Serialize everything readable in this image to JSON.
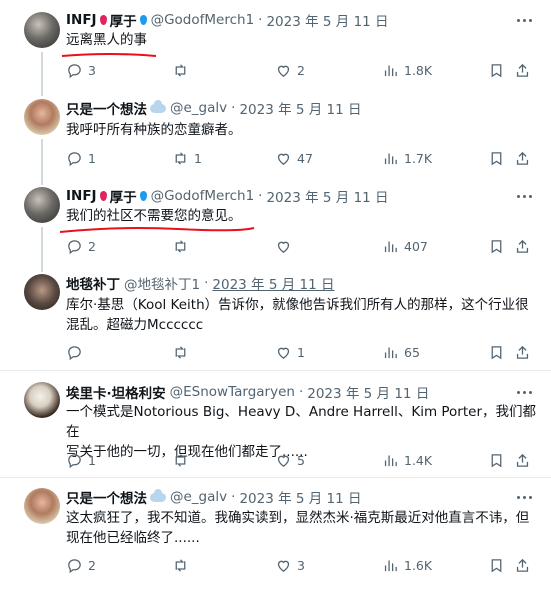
{
  "tweets": [
    {
      "author": "INFJ",
      "author_suffix": "厚于",
      "handle": "@GodofMerch1",
      "date": "2023 年 5 月 11 日",
      "text": "远离黑人的事",
      "stats": {
        "replies": "3",
        "retweets": "",
        "likes": "2",
        "views": "1.8K"
      }
    },
    {
      "author": "只是一个想法",
      "author_suffix": "",
      "handle": "@e_galv",
      "date": "2023 年 5 月 11 日",
      "text": "我呼吁所有种族的恋童癖者。",
      "stats": {
        "replies": "1",
        "retweets": "1",
        "likes": "47",
        "views": "1.7K"
      }
    },
    {
      "author": "INFJ",
      "author_suffix": "厚于",
      "handle": "@GodofMerch1",
      "date": "2023 年 5 月 11 日",
      "text": "我们的社区不需要您的意见。",
      "stats": {
        "replies": "2",
        "retweets": "",
        "likes": "",
        "views": "407"
      }
    },
    {
      "author": "地毯补丁",
      "author_suffix": "",
      "handle": "@地毯补丁1",
      "date": "2023 年 5 月 11 日",
      "text_lines": [
        "库尔·基思（Kool Keith）告诉你，就像他告诉我们所有人的那样，这个行业很",
        "混乱。超磁力Mcccccc"
      ],
      "stats": {
        "replies": "",
        "retweets": "",
        "likes": "1",
        "views": "65"
      }
    },
    {
      "author": "埃里卡·坦格利安",
      "author_suffix": "",
      "handle": "@ESnowTargaryen",
      "date": "2023 年 5 月 11 日",
      "text_lines": [
        "一个模式是Notorious Big、Heavy D、Andre Harrell、Kim Porter，我们都在",
        "写关于他的一切，但现在他们都走了......"
      ],
      "stats": {
        "replies": "1",
        "retweets": "",
        "likes": "5",
        "views": "1.4K"
      }
    },
    {
      "author": "只是一个想法",
      "author_suffix": "",
      "handle": "@e_galv",
      "date": "2023 年 5 月 11 日",
      "text_lines": [
        "这太疯狂了，我不知道。我确实读到，显然杰米·福克斯最近对他直言不讳，但",
        "现在他已经临终了......"
      ],
      "stats": {
        "replies": "2",
        "retweets": "",
        "likes": "3",
        "views": "1.6K"
      }
    }
  ],
  "colors": {
    "annotation": "#e8101a",
    "muted": "#536471",
    "line": "#cfd9de"
  },
  "icons": [
    "reply-icon",
    "retweet-icon",
    "like-icon",
    "views-icon",
    "bookmark-icon",
    "share-icon",
    "more-icon"
  ]
}
